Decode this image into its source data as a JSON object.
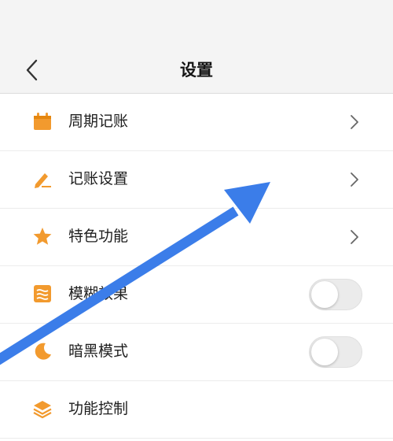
{
  "header": {
    "title": "设置",
    "back_icon": "chevron-left-icon"
  },
  "settings": {
    "items": [
      {
        "label": "周期记账",
        "icon": "calendar-icon",
        "control": "chevron"
      },
      {
        "label": "记账设置",
        "icon": "pen-icon",
        "control": "chevron"
      },
      {
        "label": "特色功能",
        "icon": "star-icon",
        "control": "chevron"
      },
      {
        "label": "模糊效果",
        "icon": "blur-icon",
        "control": "toggle",
        "enabled": false
      },
      {
        "label": "暗黑模式",
        "icon": "moon-icon",
        "control": "toggle",
        "enabled": false
      },
      {
        "label": "功能控制",
        "icon": "layers-icon",
        "control": "none"
      }
    ]
  },
  "colors": {
    "accent_icon": "#f29a2e",
    "annotation_arrow": "#3b7de9",
    "toggle_off": "#ebebeb"
  }
}
